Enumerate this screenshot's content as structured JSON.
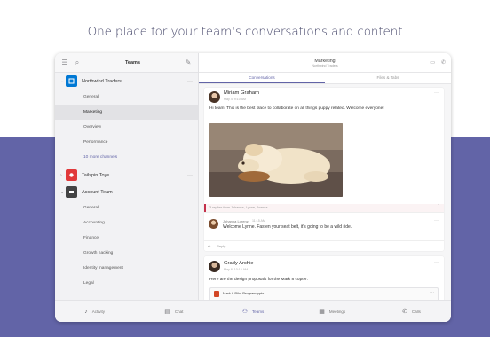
{
  "headline": "One place for your team's conversations and content",
  "sidebar": {
    "title": "Teams",
    "teams": [
      {
        "name": "Northwind Traders",
        "color": "#0078d4",
        "channels": [
          "General",
          "Marketing",
          "Overview",
          "Performance",
          "10 more channels"
        ]
      },
      {
        "name": "Tailspin Toys",
        "color": "#e1393a",
        "channels": []
      },
      {
        "name": "Account Team",
        "color": "#444444",
        "channels": [
          "General",
          "Accounting",
          "Finance",
          "Growth hacking",
          "Identity management",
          "Legal"
        ]
      }
    ]
  },
  "channel_header": {
    "title": "Marketing",
    "subtitle": "Northwind Traders",
    "tabs": [
      "Conversations",
      "Files & Tabs"
    ]
  },
  "posts": [
    {
      "author": "Miriam Graham",
      "time": "May 4, 9:10 AM",
      "text": "Hi team! This is the best place to collaborate on all things puppy related. Welcome everyone!",
      "likes": "3 replies from Johanna, Lynne, Joanna",
      "reply": {
        "author": "Johanna Lorenz",
        "time": "11:15 AM",
        "text": "Welcome Lynne. Fasten your seat belt, it's going to be a wild ride."
      },
      "reply_label": "Reply"
    },
    {
      "author": "Grady Archie",
      "time": "May 8, 10:16 AM",
      "text": "Here are the design proposals for the Mark 8 copter.",
      "attachment": "Mark 8 Pilot Program.pptx"
    }
  ],
  "bottom_nav": [
    {
      "label": "Activity",
      "icon": "bell-icon"
    },
    {
      "label": "Chat",
      "icon": "chat-icon"
    },
    {
      "label": "Teams",
      "icon": "teams-icon",
      "active": true
    },
    {
      "label": "Meetings",
      "icon": "calendar-icon"
    },
    {
      "label": "Calls",
      "icon": "phone-icon"
    }
  ],
  "colors": {
    "accent": "#6264a7",
    "band": "#6264a7"
  }
}
